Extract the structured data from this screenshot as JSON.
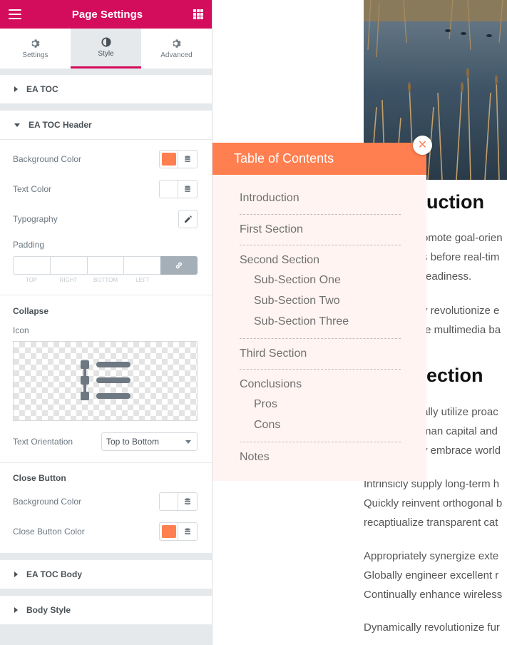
{
  "sidebar": {
    "title": "Page Settings",
    "tabs": [
      {
        "label": "Settings",
        "icon": "gear-icon"
      },
      {
        "label": "Style",
        "icon": "half-circle-icon"
      },
      {
        "label": "Advanced",
        "icon": "gear-icon"
      }
    ],
    "active_tab": "Style",
    "sections": {
      "ea_toc": "EA TOC",
      "ea_toc_header": "EA TOC Header",
      "ea_toc_body": "EA TOC Body",
      "body_style": "Body Style"
    },
    "header_controls": {
      "background_color_label": "Background Color",
      "background_color_value": "#ff7f50",
      "text_color_label": "Text Color",
      "text_color_value": "#ffffff",
      "typography_label": "Typography",
      "padding_label": "Padding",
      "padding_sides": [
        "TOP",
        "RIGHT",
        "BOTTOM",
        "LEFT"
      ],
      "collapse_heading": "Collapse",
      "icon_label": "Icon",
      "text_orientation_label": "Text Orientation",
      "text_orientation_value": "Top to Bottom",
      "close_button_heading": "Close Button",
      "close_bg_label": "Background Color",
      "close_bg_value": "#ffffff",
      "close_color_label": "Close Button Color",
      "close_color_value": "#ff7f50"
    },
    "colors": {
      "brand": "#d30c5c",
      "panel_bg": "#e6e9ec",
      "label": "#6d7882"
    }
  },
  "toc": {
    "title": "Table of Contents",
    "close_glyph": "✕",
    "items": [
      {
        "label": "Introduction",
        "level": 1
      },
      {
        "label": "First Section",
        "level": 1
      },
      {
        "label": "Second Section",
        "level": 1
      },
      {
        "label": "Sub-Section One",
        "level": 2
      },
      {
        "label": "Sub-Section Two",
        "level": 2
      },
      {
        "label": "Sub-Section Three",
        "level": 2
      },
      {
        "label": "Third Section",
        "level": 1
      },
      {
        "label": "Conclusions",
        "level": 1
      },
      {
        "label": "Pros",
        "level": 2
      },
      {
        "label": "Cons",
        "level": 2
      },
      {
        "label": "Notes",
        "level": 1
      }
    ],
    "header_color": "#ff7f50",
    "body_color": "#fff4f1"
  },
  "article": {
    "heading1": "uction",
    "p1": [
      "omote goal-orien",
      "s before real-tim",
      "readiness."
    ],
    "p2": [
      "y revolutionize e",
      "te multimedia ba"
    ],
    "heading2": "ection",
    "p3": [
      "ally utilize proac",
      "man capital and",
      "y embrace world"
    ],
    "p4": [
      "Intrinsicly supply long-term h",
      "Quickly reinvent orthogonal b",
      "recaptiualize transparent cat"
    ],
    "p5": [
      "Appropriately synergize exte",
      "Globally engineer excellent r",
      "Continually enhance wireless"
    ],
    "p6": [
      "Dynamically revolutionize fur"
    ]
  }
}
